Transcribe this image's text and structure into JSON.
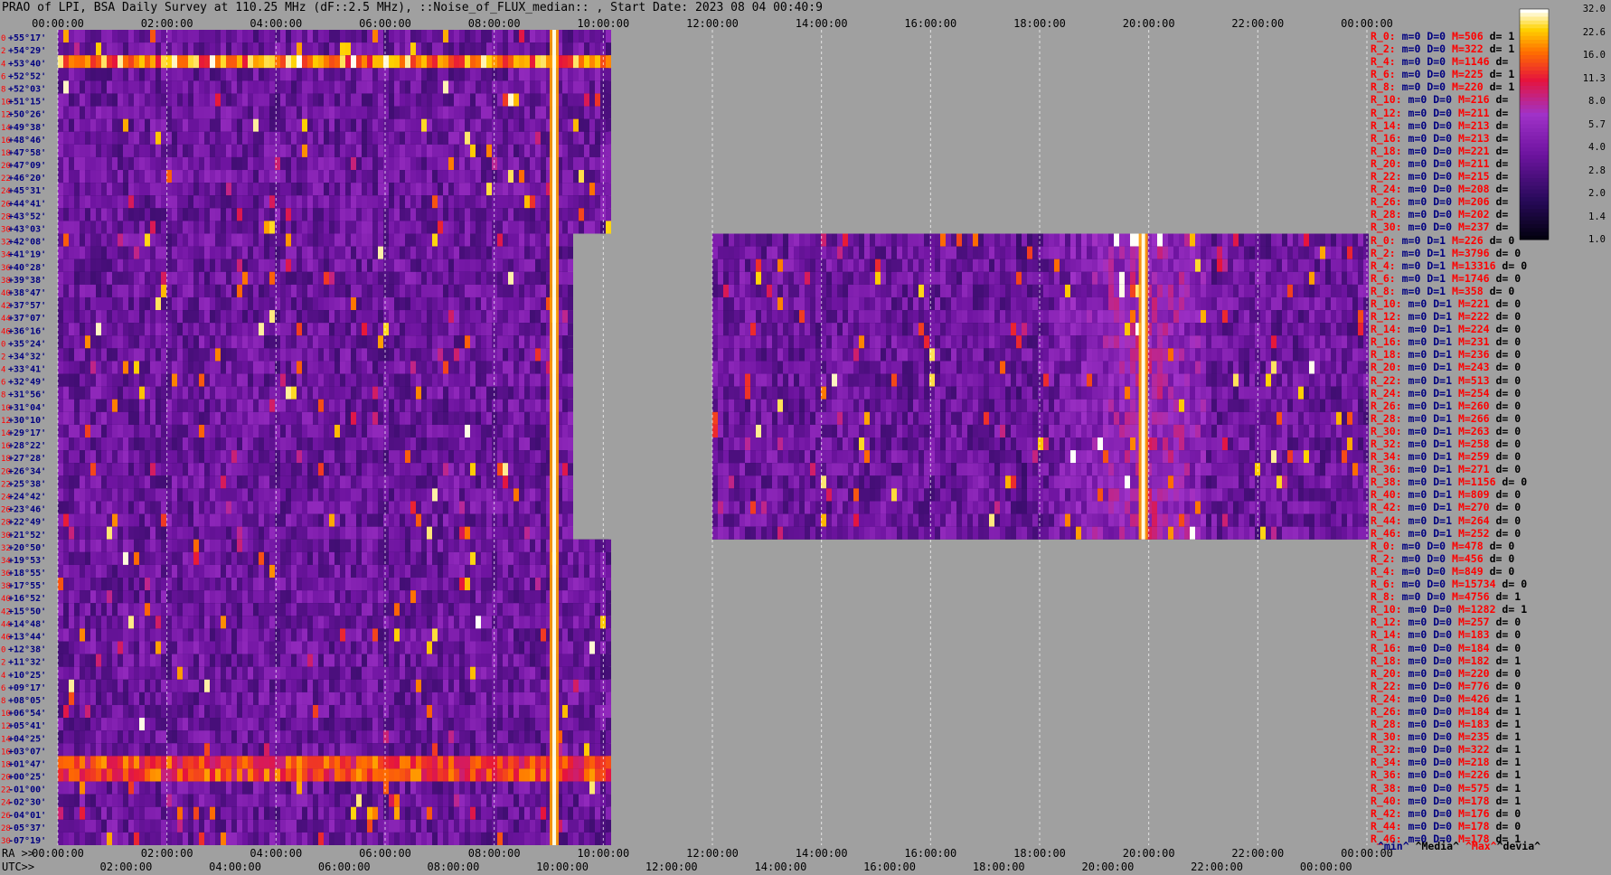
{
  "title": "PRAO of LPI, BSA Daily Survey at 110.25 MHz (dF::2.5 MHz), ::Noise_of_FLUX_median:: , Start Date: 2023 08 04 00:40:9",
  "colors": {
    "background": "#a0a0a0",
    "label_red": "#ff0000",
    "label_navy": "#000080",
    "grid_line": "#ffffff"
  },
  "bottom_axis": {
    "ra_prefix": "RA >>",
    "utc_prefix": "UTC>>"
  },
  "legend_keys": {
    "min": "^min^",
    "media": "^Media^",
    "max": "^Max^",
    "devia": "^devia^"
  },
  "chart_data": {
    "type": "heatmap",
    "title": "PRAO of LPI, BSA Daily Survey at 110.25 MHz (dF::2.5 MHz), ::Noise_of_FLUX_median:: , Start Date: 2023 08 04 00:40:9",
    "x_ticks_top": [
      "00:00:00",
      "02:00:00",
      "04:00:00",
      "06:00:00",
      "08:00:00",
      "10:00:00",
      "12:00:00",
      "14:00:00",
      "16:00:00",
      "18:00:00",
      "20:00:00",
      "22:00:00",
      "00:00:00"
    ],
    "x_ticks_ra": [
      "00:00:00",
      "02:00:00",
      "04:00:00",
      "06:00:00",
      "08:00:00",
      "10:00:00",
      "12:00:00",
      "14:00:00",
      "16:00:00",
      "18:00:00",
      "20:00:00",
      "22:00:00",
      "00:00:00"
    ],
    "x_ticks_utc": [
      "02:00:00",
      "04:00:00",
      "06:00:00",
      "08:00:00",
      "10:00:00",
      "12:00:00",
      "14:00:00",
      "16:00:00",
      "18:00:00",
      "20:00:00",
      "22:00:00",
      "00:00:00"
    ],
    "y_beam_index": [
      "0",
      "2",
      "4",
      "6",
      "8",
      "10",
      "12",
      "14",
      "16",
      "18",
      "20",
      "22",
      "24",
      "26",
      "28",
      "30",
      "32",
      "34",
      "36",
      "38",
      "40",
      "42",
      "44",
      "46",
      "0",
      "2",
      "4",
      "6",
      "8",
      "10",
      "12",
      "14",
      "16",
      "18",
      "20",
      "22",
      "24",
      "26",
      "28",
      "30",
      "32",
      "34",
      "36",
      "38",
      "40",
      "42",
      "44",
      "46",
      "0",
      "2",
      "4",
      "6",
      "8",
      "10",
      "12",
      "14",
      "16",
      "18",
      "20",
      "22",
      "24",
      "26",
      "28",
      "30",
      "32",
      "34",
      "36",
      "38",
      "40",
      "42",
      "44",
      "46"
    ],
    "y_dec": [
      "+55°17'",
      "+54°29'",
      "+53°40'",
      "+52°52'",
      "+52°03'",
      "+51°15'",
      "+50°26'",
      "+49°38'",
      "+48°46'",
      "+47°58'",
      "+47°09'",
      "+46°20'",
      "+45°31'",
      "+44°41'",
      "+43°52'",
      "+43°03'",
      "+42°08'",
      "+41°19'",
      "+40°28'",
      "+39°38'",
      "+38°47'",
      "+37°57'",
      "+37°07'",
      "+36°16'",
      "+35°24'",
      "+34°32'",
      "+33°41'",
      "+32°49'",
      "+31°56'",
      "+31°04'",
      "+30°10'",
      "+29°17'",
      "+28°22'",
      "+27°28'",
      "+26°34'",
      "+25°38'",
      "+24°42'",
      "+23°46'",
      "+22°49'",
      "+21°52'",
      "+20°50'",
      "+19°53'",
      "+18°55'",
      "+17°55'",
      "+16°52'",
      "+15°50'",
      "+14°48'",
      "+13°44'",
      "+12°38'",
      "+11°32'",
      "+10°25'",
      "+09°17'",
      "+08°05'",
      "+06°54'",
      "+05°41'",
      "+04°25'",
      "+03°07'",
      "+01°47'",
      "+00°25'",
      "-01°00'",
      "-02°30'",
      "-04°01'",
      "-05°37'",
      "-07°19'"
    ],
    "colorbar": {
      "ticks": [
        "32.0",
        "22.6",
        "16.0",
        "11.3",
        "8.0",
        "5.7",
        "4.0",
        "2.8",
        "2.0",
        "1.4",
        "1.0"
      ],
      "scale": "log"
    },
    "stats": [
      {
        "r": "R_0:",
        "m": "m=0",
        "D": "D=0",
        "M": "M=506",
        "d": "d= 1"
      },
      {
        "r": "R_2:",
        "m": "m=0",
        "D": "D=0",
        "M": "M=322",
        "d": "d= 1"
      },
      {
        "r": "R_4:",
        "m": "m=0",
        "D": "D=0",
        "M": "M=1146",
        "d": "d="
      },
      {
        "r": "R_6:",
        "m": "m=0",
        "D": "D=0",
        "M": "M=225",
        "d": "d= 1"
      },
      {
        "r": "R_8:",
        "m": "m=0",
        "D": "D=0",
        "M": "M=220",
        "d": "d= 1"
      },
      {
        "r": "R_10:",
        "m": "m=0",
        "D": "D=0",
        "M": "M=216",
        "d": "d="
      },
      {
        "r": "R_12:",
        "m": "m=0",
        "D": "D=0",
        "M": "M=211",
        "d": "d="
      },
      {
        "r": "R_14:",
        "m": "m=0",
        "D": "D=0",
        "M": "M=213",
        "d": "d="
      },
      {
        "r": "R_16:",
        "m": "m=0",
        "D": "D=0",
        "M": "M=213",
        "d": "d="
      },
      {
        "r": "R_18:",
        "m": "m=0",
        "D": "D=0",
        "M": "M=221",
        "d": "d="
      },
      {
        "r": "R_20:",
        "m": "m=0",
        "D": "D=0",
        "M": "M=211",
        "d": "d="
      },
      {
        "r": "R_22:",
        "m": "m=0",
        "D": "D=0",
        "M": "M=215",
        "d": "d="
      },
      {
        "r": "R_24:",
        "m": "m=0",
        "D": "D=0",
        "M": "M=208",
        "d": "d="
      },
      {
        "r": "R_26:",
        "m": "m=0",
        "D": "D=0",
        "M": "M=206",
        "d": "d="
      },
      {
        "r": "R_28:",
        "m": "m=0",
        "D": "D=0",
        "M": "M=202",
        "d": "d="
      },
      {
        "r": "R_30:",
        "m": "m=0",
        "D": "D=0",
        "M": "M=237",
        "d": "d="
      },
      {
        "r": "R_0:",
        "m": "m=0",
        "D": "D=1",
        "M": "M=226",
        "d": "d= 0"
      },
      {
        "r": "R_2:",
        "m": "m=0",
        "D": "D=1",
        "M": "M=3796",
        "d": "d= 0"
      },
      {
        "r": "R_4:",
        "m": "m=0",
        "D": "D=1",
        "M": "M=13316",
        "d": "d= 0"
      },
      {
        "r": "R_6:",
        "m": "m=0",
        "D": "D=1",
        "M": "M=1746",
        "d": "d= 0"
      },
      {
        "r": "R_8:",
        "m": "m=0",
        "D": "D=1",
        "M": "M=358",
        "d": "d= 0"
      },
      {
        "r": "R_10:",
        "m": "m=0",
        "D": "D=1",
        "M": "M=221",
        "d": "d= 0"
      },
      {
        "r": "R_12:",
        "m": "m=0",
        "D": "D=1",
        "M": "M=222",
        "d": "d= 0"
      },
      {
        "r": "R_14:",
        "m": "m=0",
        "D": "D=1",
        "M": "M=224",
        "d": "d= 0"
      },
      {
        "r": "R_16:",
        "m": "m=0",
        "D": "D=1",
        "M": "M=231",
        "d": "d= 0"
      },
      {
        "r": "R_18:",
        "m": "m=0",
        "D": "D=1",
        "M": "M=236",
        "d": "d= 0"
      },
      {
        "r": "R_20:",
        "m": "m=0",
        "D": "D=1",
        "M": "M=243",
        "d": "d= 0"
      },
      {
        "r": "R_22:",
        "m": "m=0",
        "D": "D=1",
        "M": "M=513",
        "d": "d= 0"
      },
      {
        "r": "R_24:",
        "m": "m=0",
        "D": "D=1",
        "M": "M=254",
        "d": "d= 0"
      },
      {
        "r": "R_26:",
        "m": "m=0",
        "D": "D=1",
        "M": "M=260",
        "d": "d= 0"
      },
      {
        "r": "R_28:",
        "m": "m=0",
        "D": "D=1",
        "M": "M=266",
        "d": "d= 0"
      },
      {
        "r": "R_30:",
        "m": "m=0",
        "D": "D=1",
        "M": "M=263",
        "d": "d= 0"
      },
      {
        "r": "R_32:",
        "m": "m=0",
        "D": "D=1",
        "M": "M=258",
        "d": "d= 0"
      },
      {
        "r": "R_34:",
        "m": "m=0",
        "D": "D=1",
        "M": "M=259",
        "d": "d= 0"
      },
      {
        "r": "R_36:",
        "m": "m=0",
        "D": "D=1",
        "M": "M=271",
        "d": "d= 0"
      },
      {
        "r": "R_38:",
        "m": "m=0",
        "D": "D=1",
        "M": "M=1156",
        "d": "d= 0"
      },
      {
        "r": "R_40:",
        "m": "m=0",
        "D": "D=1",
        "M": "M=809",
        "d": "d= 0"
      },
      {
        "r": "R_42:",
        "m": "m=0",
        "D": "D=1",
        "M": "M=270",
        "d": "d= 0"
      },
      {
        "r": "R_44:",
        "m": "m=0",
        "D": "D=1",
        "M": "M=264",
        "d": "d= 0"
      },
      {
        "r": "R_46:",
        "m": "m=0",
        "D": "D=1",
        "M": "M=252",
        "d": "d= 0"
      },
      {
        "r": "R_0:",
        "m": "m=0",
        "D": "D=0",
        "M": "M=478",
        "d": "d= 0"
      },
      {
        "r": "R_2:",
        "m": "m=0",
        "D": "D=0",
        "M": "M=456",
        "d": "d= 0"
      },
      {
        "r": "R_4:",
        "m": "m=0",
        "D": "D=0",
        "M": "M=849",
        "d": "d= 0"
      },
      {
        "r": "R_6:",
        "m": "m=0",
        "D": "D=0",
        "M": "M=15734",
        "d": "d= 0"
      },
      {
        "r": "R_8:",
        "m": "m=0",
        "D": "D=0",
        "M": "M=4756",
        "d": "d= 1"
      },
      {
        "r": "R_10:",
        "m": "m=0",
        "D": "D=0",
        "M": "M=1282",
        "d": "d= 1"
      },
      {
        "r": "R_12:",
        "m": "m=0",
        "D": "D=0",
        "M": "M=257",
        "d": "d= 0"
      },
      {
        "r": "R_14:",
        "m": "m=0",
        "D": "D=0",
        "M": "M=183",
        "d": "d= 0"
      },
      {
        "r": "R_16:",
        "m": "m=0",
        "D": "D=0",
        "M": "M=184",
        "d": "d= 0"
      },
      {
        "r": "R_18:",
        "m": "m=0",
        "D": "D=0",
        "M": "M=182",
        "d": "d= 1"
      },
      {
        "r": "R_20:",
        "m": "m=0",
        "D": "D=0",
        "M": "M=220",
        "d": "d= 0"
      },
      {
        "r": "R_22:",
        "m": "m=0",
        "D": "D=0",
        "M": "M=776",
        "d": "d= 0"
      },
      {
        "r": "R_24:",
        "m": "m=0",
        "D": "D=0",
        "M": "M=426",
        "d": "d= 1"
      },
      {
        "r": "R_26:",
        "m": "m=0",
        "D": "D=0",
        "M": "M=184",
        "d": "d= 1"
      },
      {
        "r": "R_28:",
        "m": "m=0",
        "D": "D=0",
        "M": "M=183",
        "d": "d= 1"
      },
      {
        "r": "R_30:",
        "m": "m=0",
        "D": "D=0",
        "M": "M=235",
        "d": "d= 1"
      },
      {
        "r": "R_32:",
        "m": "m=0",
        "D": "D=0",
        "M": "M=322",
        "d": "d= 1"
      },
      {
        "r": "R_34:",
        "m": "m=0",
        "D": "D=0",
        "M": "M=218",
        "d": "d= 1"
      },
      {
        "r": "R_36:",
        "m": "m=0",
        "D": "D=0",
        "M": "M=226",
        "d": "d= 1"
      },
      {
        "r": "R_38:",
        "m": "m=0",
        "D": "D=0",
        "M": "M=575",
        "d": "d= 1"
      },
      {
        "r": "R_40:",
        "m": "m=0",
        "D": "D=0",
        "M": "M=178",
        "d": "d= 1"
      },
      {
        "r": "R_42:",
        "m": "m=0",
        "D": "D=0",
        "M": "M=176",
        "d": "d= 0"
      },
      {
        "r": "R_44:",
        "m": "m=0",
        "D": "D=0",
        "M": "M=178",
        "d": "d= 0"
      },
      {
        "r": "R_46:",
        "m": "m=0",
        "D": "D=0",
        "M": "M=178",
        "d": "d= 1"
      }
    ],
    "coverage_hours": [
      {
        "block": 1,
        "start": 0.0,
        "end": 10.1
      },
      {
        "block": 2,
        "start": 12.0,
        "end": 24.0
      },
      {
        "block": 3,
        "start": 0.0,
        "end": 10.1
      }
    ],
    "features": [
      {
        "label": "strong transit source",
        "hour": 9.1,
        "dec_from": "+55°17'",
        "dec_to": "-07°19'"
      },
      {
        "label": "strong transit source",
        "hour": 19.9,
        "dec_from": "+42°08'",
        "dec_to": "+21°52'"
      }
    ]
  }
}
